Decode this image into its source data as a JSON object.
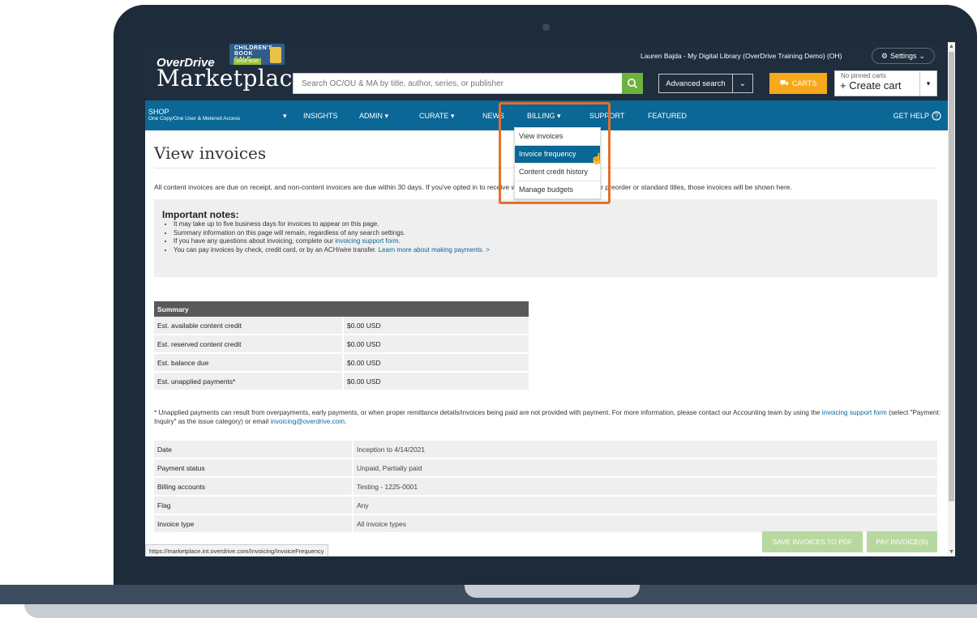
{
  "header": {
    "brand_small": "OverDrive",
    "brand_big": "Marketplace",
    "promo": {
      "text": "CHILDREN'S BOOK SALE",
      "cta": "SHOP NOW"
    },
    "user_line": "Lauren Bajda - My Digital Library (OverDrive Training Demo) (OH)",
    "settings_label": "Settings",
    "search_placeholder": "Search OC/OU & MA by title, author, series, or publisher",
    "advanced_search_label": "Advanced search",
    "carts_label": "CARTS",
    "pinned_carts": "No pinned carts",
    "create_cart_label": "Create cart"
  },
  "nav": {
    "shop": {
      "label": "SHOP",
      "sub": "One Copy/One User & Metered Access"
    },
    "items": [
      "INSIGHTS",
      "ADMIN",
      "CURATE",
      "NEWS",
      "BILLING",
      "SUPPORT",
      "FEATURED"
    ],
    "help": "GET HELP"
  },
  "billing_menu": {
    "items": [
      "View invoices",
      "Invoice frequency",
      "Content credit history",
      "Manage budgets"
    ],
    "active_index": 1
  },
  "page": {
    "title": "View invoices",
    "intro": "All content invoices are due on receipt, and non-content invoices are due within 30 days. If you've opted in to receive weekly or monthly invoices for preorder or standard titles, those invoices will be shown here.",
    "notes_heading": "Important notes:",
    "notes": [
      "It may take up to five business days for invoices to appear on this page.",
      "Summary information on this page will remain, regardless of any search settings.",
      "If you have any questions about invoicing, complete our ",
      "You can pay invoices by check, credit card, or by an ACH/wire transfer. "
    ],
    "notes_link_support": "invoicing support form.",
    "notes_link_payments": "Learn more about making payments. >"
  },
  "summary": {
    "header": "Summary",
    "rows": [
      {
        "label": "Est. available content credit",
        "value": "$0.00 USD"
      },
      {
        "label": "Est. reserved content credit",
        "value": "$0.00 USD"
      },
      {
        "label": "Est. balance due",
        "value": "$0.00 USD"
      },
      {
        "label": "Est. unapplied payments*",
        "value": "$0.00 USD"
      }
    ]
  },
  "footnote": {
    "part1": "* Unapplied payments can result from overpayments, early payments, or when proper remittance details/invoices being paid are not provided with payment. For more information, please contact our Accounting team by using the ",
    "link1": "invoicing support form",
    "part2": " (select \"Payment: Inquiry\" as the issue category) or email ",
    "link2": "invoicing@overdrive.com",
    "part3": "."
  },
  "filters": [
    {
      "label": "Date",
      "value": "Inception to 4/14/2021"
    },
    {
      "label": "Payment status",
      "value": "Unpaid, Partially paid"
    },
    {
      "label": "Billing accounts",
      "value": "Testing - 1225-0001"
    },
    {
      "label": "Flag",
      "value": "Any"
    },
    {
      "label": "Invoice type",
      "value": "All invoice types"
    }
  ],
  "status_url": "https://marketplace.int.overdrive.com/Invoicing/InvoiceFrequency",
  "actions": {
    "save_pdf": "SAVE INVOICES TO PDF",
    "pay": "PAY INVOICE(S)"
  },
  "colors": {
    "header_bg": "#1f2d3d",
    "nav_bg": "#0a6796",
    "accent_green": "#6cb33e",
    "carts_orange": "#f7a81b",
    "highlight_orange": "#e46f2c"
  }
}
